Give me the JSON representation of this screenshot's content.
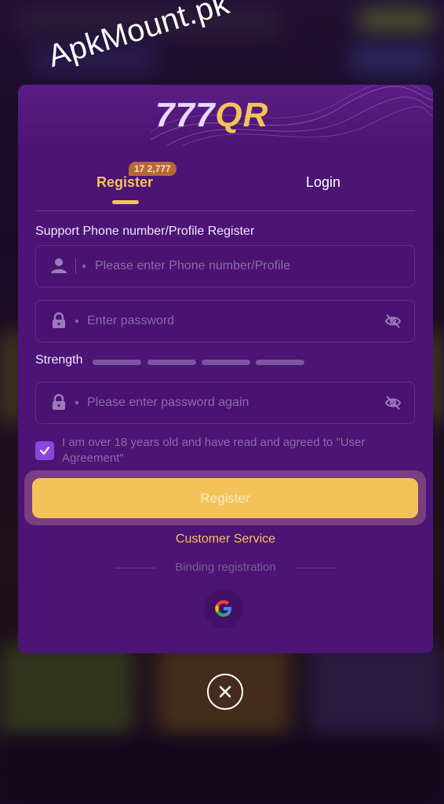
{
  "watermark": "ApkMount.pk",
  "logo": {
    "part1": "777",
    "part2": "QR"
  },
  "tabs": {
    "register": "Register",
    "login": "Login",
    "badge": "17 2,777"
  },
  "form": {
    "section_label": "Support Phone number/Profile Register",
    "phone_placeholder": "Please enter Phone number/Profile",
    "password_placeholder": "Enter password",
    "strength_label": "Strength",
    "confirm_placeholder": "Please enter password again",
    "agree_text": "I am over 18 years old and have read and agreed to \"User Agreement\"",
    "agree_checked": true,
    "register_button": "Register",
    "customer_service": "Customer Service",
    "binding_text": "Binding registration"
  },
  "icons": {
    "user": "user-icon",
    "lock": "lock-icon",
    "eye_off": "eye-off-icon",
    "check": "check-icon",
    "google": "google-icon",
    "close": "close-icon"
  },
  "colors": {
    "modal_bg": "#4c1475",
    "accent": "#f3c35a",
    "checkbox": "#8a46e0"
  }
}
